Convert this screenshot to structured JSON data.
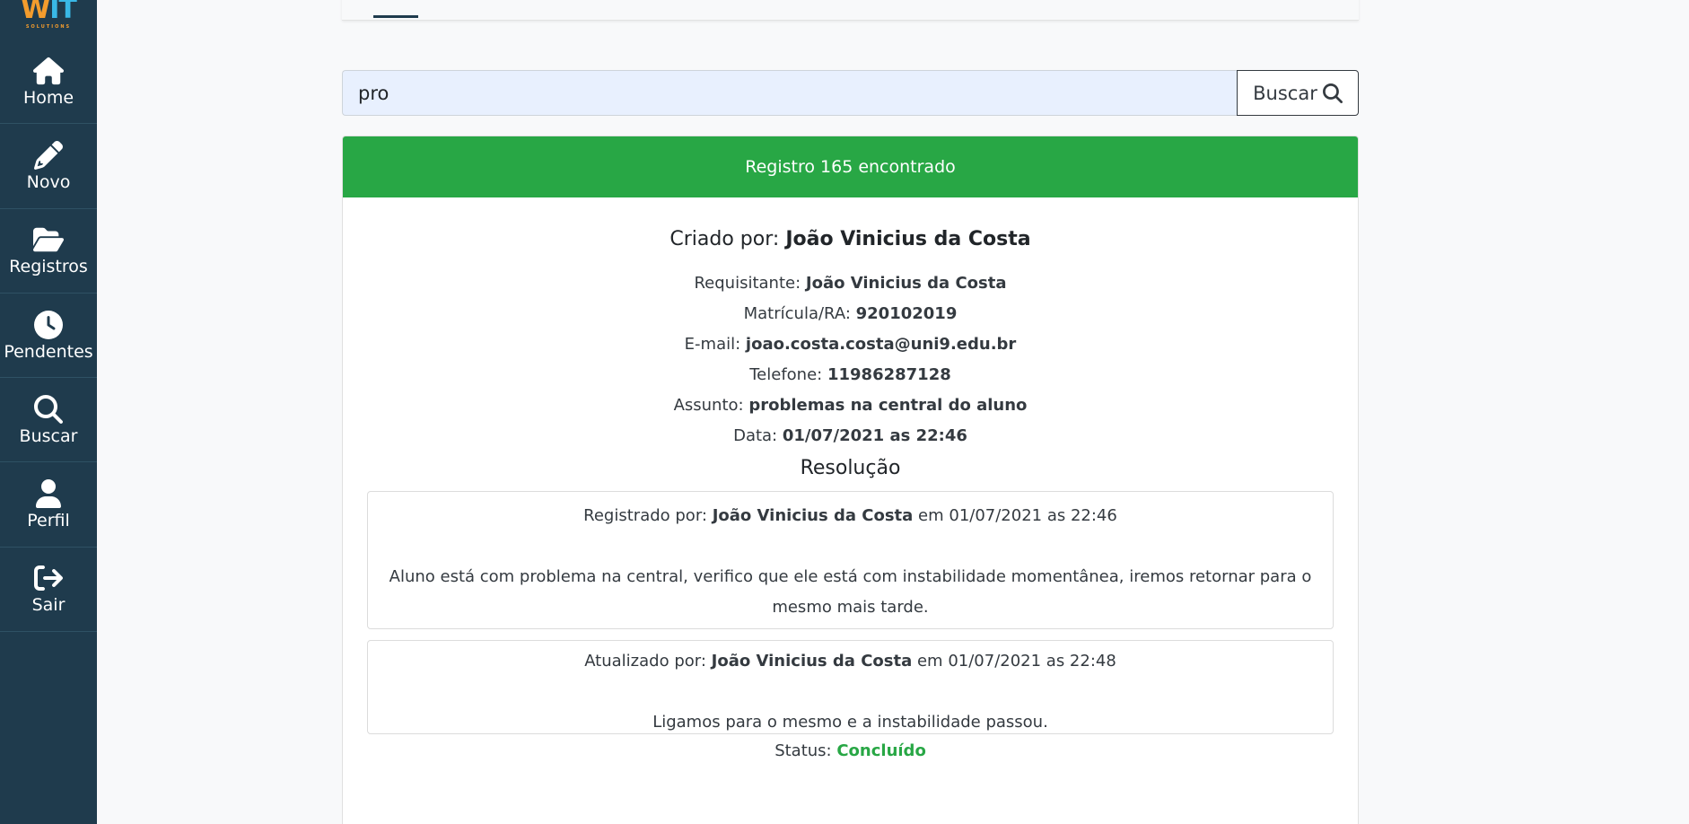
{
  "logo": {
    "text_w": "W",
    "text_t": "IT",
    "sub": "SOLUTIONS"
  },
  "sidebar": {
    "items": [
      {
        "label": "Home",
        "icon": "home-icon"
      },
      {
        "label": "Novo",
        "icon": "pencil-icon"
      },
      {
        "label": "Registros",
        "icon": "folder-open-icon"
      },
      {
        "label": "Pendentes",
        "icon": "clock-icon"
      },
      {
        "label": "Buscar",
        "icon": "search-icon"
      },
      {
        "label": "Perfil",
        "icon": "user-icon"
      },
      {
        "label": "Sair",
        "icon": "sign-out-icon"
      }
    ]
  },
  "search": {
    "value": "pro",
    "button_label": "Buscar"
  },
  "record": {
    "header": "Registro 165 encontrado",
    "created_by_label": "Criado por:",
    "created_by": "João Vinicius da Costa",
    "fields": [
      {
        "label": "Requisitante:",
        "value": "João Vinicius da Costa"
      },
      {
        "label": "Matrícula/RA:",
        "value": "920102019"
      },
      {
        "label": "E-mail:",
        "value": "joao.costa.costa@uni9.edu.br"
      },
      {
        "label": "Telefone:",
        "value": "11986287128"
      },
      {
        "label": "Assunto:",
        "value": "problemas na central do aluno"
      },
      {
        "label": "Data:",
        "value": "01/07/2021 as 22:46"
      }
    ],
    "resolution_title": "Resolução",
    "entries": [
      {
        "prefix": "Registrado por:",
        "author": "João Vinicius da Costa",
        "suffix": "em 01/07/2021 as 22:46",
        "text": "Aluno está com problema na central, verifico que ele está com instabilidade momentânea, iremos retornar para o mesmo mais tarde."
      },
      {
        "prefix": "Atualizado por:",
        "author": "João Vinicius da Costa",
        "suffix": "em 01/07/2021 as 22:48",
        "text": "Ligamos para o mesmo e a instabilidade passou."
      }
    ],
    "status_label": "Status:",
    "status_value": "Concluído"
  },
  "colors": {
    "sidebar_bg": "#1f3b4d",
    "success": "#28a745",
    "search_bg": "#e8f0fe"
  }
}
